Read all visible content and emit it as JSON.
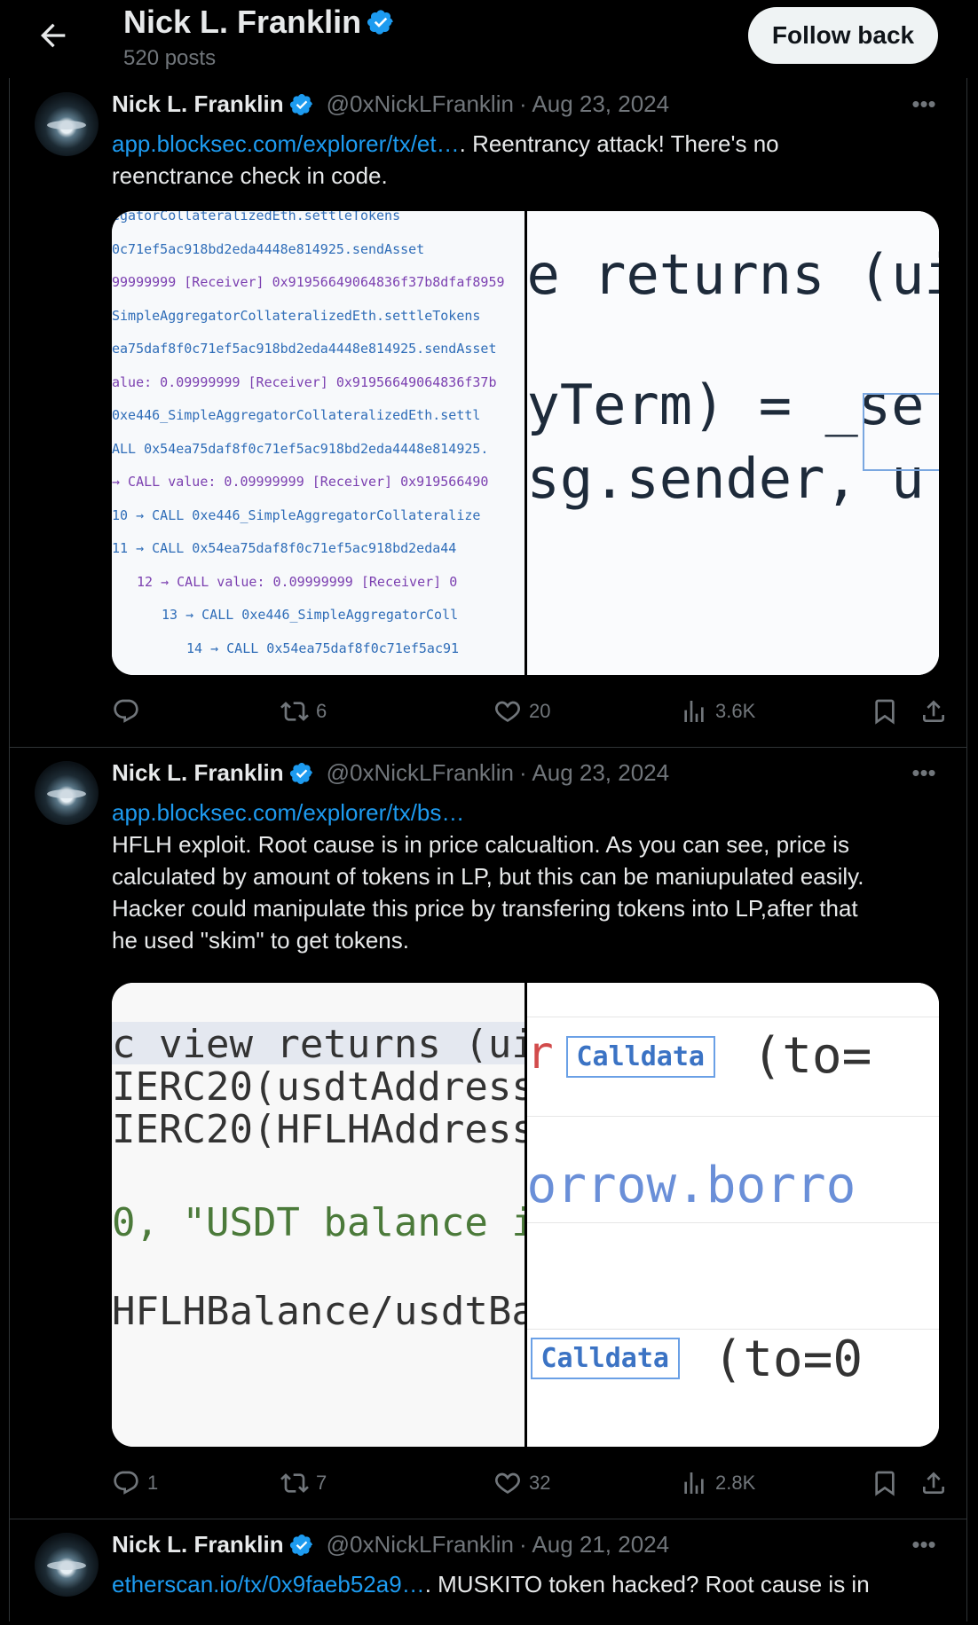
{
  "header": {
    "title": "Nick L. Franklin",
    "posts": "520 posts",
    "follow_label": "Follow back"
  },
  "tweets": [
    {
      "name": "Nick L. Franklin",
      "handle": "@0xNickLFranklin",
      "date": "· Aug 23, 2024",
      "link": "app.blocksec.com/explorer/tx/et…",
      "text_after_link": ". Reentrancy attack! There's no",
      "text_line2": "reenctrance check in code.",
      "stats": {
        "reply": "",
        "retweet": "6",
        "like": "20",
        "views": "3.6K"
      },
      "media_left_lines": [
        "egatorCollateralizedEth.settleTokens",
        "0c71ef5ac918bd2eda4448e814925.sendAsset",
        "99999999 [Receiver] 0x91956649064836f37b8dfaf8959",
        "SimpleAggregatorCollateralizedEth.settleTokens",
        "ea75daf8f0c71ef5ac918bd2eda4448e814925.sendAsset",
        "alue: 0.09999999 [Receiver] 0x91956649064836f37b",
        "0xe446_SimpleAggregatorCollateralizedEth.settl",
        "ALL  0x54ea75daf8f0c71ef5ac918bd2eda4448e814925.",
        "→ CALL  value: 0.09999999 [Receiver] 0x919566490",
        "10 → CALL  0xe446_SimpleAggregatorCollateralize",
        "11 → CALL  0x54ea75daf8f0c71ef5ac918bd2eda44",
        "12 → CALL  value: 0.09999999 [Receiver] 0",
        "13 → CALL  0xe446_SimpleAggregatorColl",
        "14 → CALL  0x54ea75daf8f0c71ef5ac91"
      ],
      "media_right_lines": [
        "e returns (ui",
        "yTerm) = _se",
        "sg.sender, u"
      ]
    },
    {
      "name": "Nick L. Franklin",
      "handle": "@0xNickLFranklin",
      "date": "· Aug 23, 2024",
      "link": "app.blocksec.com/explorer/tx/bs…",
      "body": [
        "HFLH exploit. Root cause is in price calcualtion. As you can see, price is",
        "calculated by amount of tokens in LP, but this can be maniupulated easily.",
        "Hacker could manipulate this price by transfering tokens into LP,after that",
        "he used \"skim\" to get tokens."
      ],
      "stats": {
        "reply": "1",
        "retweet": "7",
        "like": "32",
        "views": "2.8K"
      },
      "media_left_lines": [
        "c view returns (uir",
        " IERC20(usdtAddress",
        " IERC20(HFLHAddress",
        " 0, \"USDT balance i",
        "HFLHBalance/usdtBal"
      ],
      "media_right": {
        "calldata": "Calldata",
        "to": "(to=",
        "to2": "(to=0",
        "borrow": "orrow.borro"
      }
    },
    {
      "name": "Nick L. Franklin",
      "handle": "@0xNickLFranklin",
      "date": "· Aug 21, 2024",
      "link": "etherscan.io/tx/0x9faeb52a9…",
      "text_after_link": ". MUSKITO token hacked? Root cause is in"
    }
  ],
  "colors": {
    "link": "#1d9bf0",
    "verified": "#1d9bf0",
    "muted": "#71767b"
  }
}
